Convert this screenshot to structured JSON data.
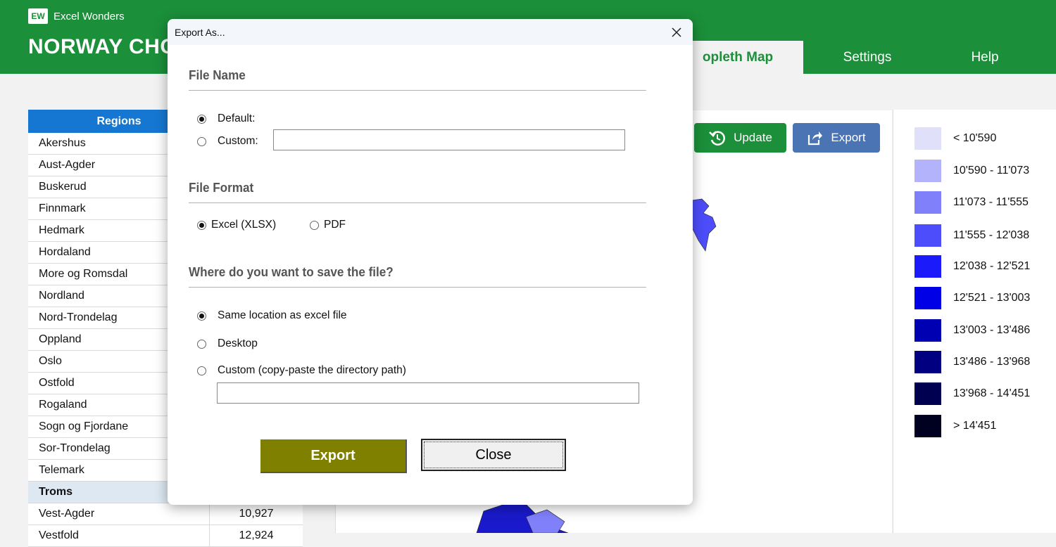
{
  "brand": {
    "logo_text": "EW",
    "name": "Excel Wonders"
  },
  "app_title": "NORWAY CHO",
  "tabs": [
    {
      "label": "opleth Map",
      "active": true
    },
    {
      "label": "Settings",
      "active": false
    },
    {
      "label": "Help",
      "active": false
    }
  ],
  "regions": {
    "header": "Regions",
    "rows": [
      {
        "name": "Akershus",
        "value": ""
      },
      {
        "name": "Aust-Agder",
        "value": ""
      },
      {
        "name": "Buskerud",
        "value": ""
      },
      {
        "name": "Finnmark",
        "value": ""
      },
      {
        "name": "Hedmark",
        "value": ""
      },
      {
        "name": "Hordaland",
        "value": ""
      },
      {
        "name": "More og Romsdal",
        "value": ""
      },
      {
        "name": "Nordland",
        "value": ""
      },
      {
        "name": "Nord-Trondelag",
        "value": ""
      },
      {
        "name": "Oppland",
        "value": ""
      },
      {
        "name": "Oslo",
        "value": ""
      },
      {
        "name": "Ostfold",
        "value": ""
      },
      {
        "name": "Rogaland",
        "value": ""
      },
      {
        "name": "Sogn og Fjordane",
        "value": ""
      },
      {
        "name": "Sor-Trondelag",
        "value": ""
      },
      {
        "name": "Telemark",
        "value": ""
      },
      {
        "name": "Troms",
        "value": "",
        "selected": true
      },
      {
        "name": "Vest-Agder",
        "value": "10,927"
      },
      {
        "name": "Vestfold",
        "value": "12,924"
      }
    ]
  },
  "actions": {
    "update_label": "Update",
    "export_label": "Export"
  },
  "legend": [
    {
      "label": "< 10'590",
      "color": "#e0e0fb"
    },
    {
      "label": "10'590 - 11'073",
      "color": "#b3b3fb"
    },
    {
      "label": "11'073 - 11'555",
      "color": "#8080fb"
    },
    {
      "label": "11'555 - 12'038",
      "color": "#4d4dfb"
    },
    {
      "label": "12'038 - 12'521",
      "color": "#1a1afb"
    },
    {
      "label": "12'521 - 13'003",
      "color": "#0000e6"
    },
    {
      "label": "13'003 - 13'486",
      "color": "#0000b3"
    },
    {
      "label": "13'486 - 13'968",
      "color": "#000080"
    },
    {
      "label": "13'968 - 14'451",
      "color": "#000050"
    },
    {
      "label": "> 14'451",
      "color": "#000020"
    }
  ],
  "dialog": {
    "title": "Export As...",
    "file_name": {
      "title": "File Name",
      "default_label": "Default:",
      "custom_label": "Custom:",
      "custom_value": ""
    },
    "file_format": {
      "title": "File Format",
      "xlsx_label": "Excel (XLSX)",
      "pdf_label": "PDF"
    },
    "save_location": {
      "title": "Where do you want to save the file?",
      "same_label": "Same location as excel file",
      "desktop_label": "Desktop",
      "custom_label": "Custom (copy-paste the directory path)",
      "custom_value": ""
    },
    "export_label": "Export",
    "close_label": "Close"
  }
}
